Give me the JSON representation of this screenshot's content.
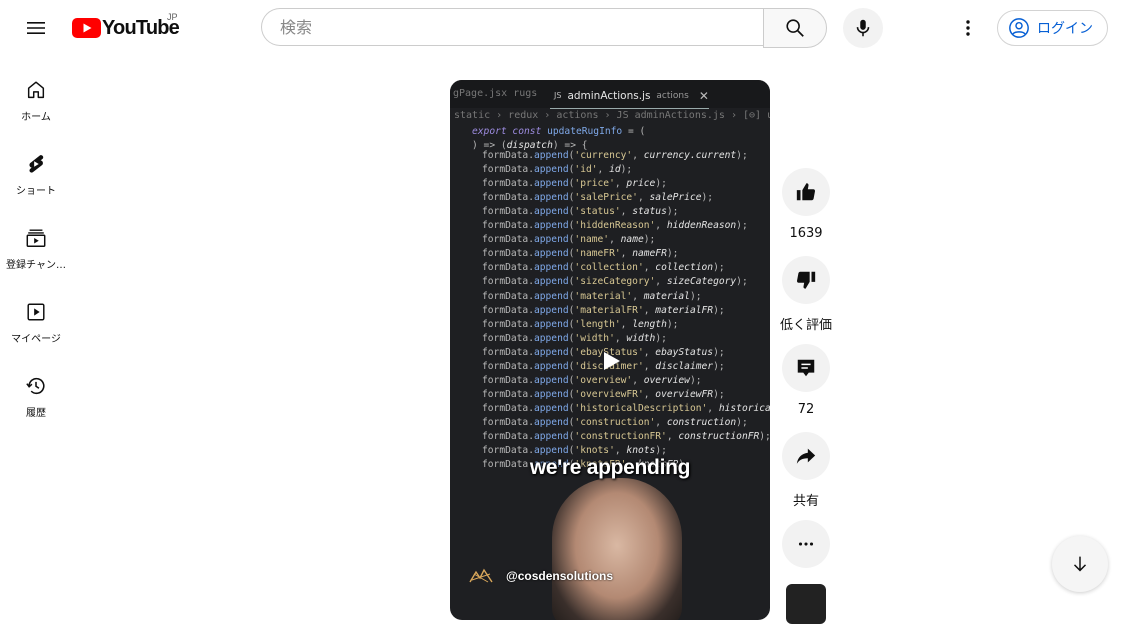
{
  "header": {
    "logo_text": "YouTube",
    "region": "JP",
    "search_placeholder": "検索",
    "login_label": "ログイン"
  },
  "sidebar": {
    "items": [
      {
        "label": "ホーム",
        "icon": "home-icon"
      },
      {
        "label": "ショート",
        "icon": "shorts-icon"
      },
      {
        "label": "登録チャン…",
        "icon": "subscriptions-icon"
      },
      {
        "label": "マイページ",
        "icon": "library-icon"
      },
      {
        "label": "履歴",
        "icon": "history-icon"
      }
    ]
  },
  "video": {
    "tab_prev": "gPage.jsx rugs",
    "tab_active_type": "JS",
    "tab_active_name": "adminActions.js",
    "tab_active_dir": "actions",
    "breadcrumb": "static › redux › actions › JS adminActions.js › [⊖] updateRugInfo",
    "code_header": [
      "export const updateRugInfo = (",
      ") => (dispatch) => {"
    ],
    "code_lines": [
      [
        "currency",
        "currency.current"
      ],
      [
        "id",
        "id"
      ],
      [
        "price",
        "price"
      ],
      [
        "salePrice",
        "salePrice"
      ],
      [
        "status",
        "status"
      ],
      [
        "hiddenReason",
        "hiddenReason"
      ],
      [
        "name",
        "name"
      ],
      [
        "nameFR",
        "nameFR"
      ],
      [
        "collection",
        "collection"
      ],
      [
        "sizeCategory",
        "sizeCategory"
      ],
      [
        "material",
        "material"
      ],
      [
        "materialFR",
        "materialFR"
      ],
      [
        "length",
        "length"
      ],
      [
        "width",
        "width"
      ],
      [
        "ebayStatus",
        "ebayStatus"
      ],
      [
        "disclaimer",
        "disclaimer"
      ],
      [
        "overview",
        "overview"
      ],
      [
        "overviewFR",
        "overviewFR"
      ],
      [
        "historicalDescription",
        "historical"
      ],
      [
        "construction",
        "construction"
      ],
      [
        "constructionFR",
        "constructionFR"
      ],
      [
        "knots",
        "knots"
      ],
      [
        "knotsFR",
        "knotsFR"
      ]
    ],
    "caption": "we're appending",
    "channel_handle": "@cosdensolutions"
  },
  "actions": {
    "like_count": "1639",
    "dislike_label": "低く評価",
    "comment_count": "72",
    "share_label": "共有"
  },
  "colors": {
    "brand_red": "#ff0000",
    "link_blue": "#065fd4",
    "action_bg": "#f2f2f2"
  }
}
